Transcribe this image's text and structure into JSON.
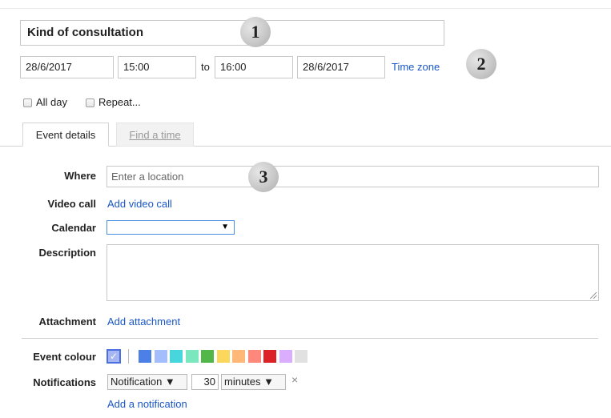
{
  "event": {
    "title": "Kind of consultation",
    "start_date": "28/6/2017",
    "start_time": "15:00",
    "to_label": "to",
    "end_time": "16:00",
    "end_date": "28/6/2017",
    "time_zone_link": "Time zone",
    "all_day_label": "All day",
    "repeat_label": "Repeat..."
  },
  "markers": [
    "1",
    "2",
    "3"
  ],
  "tabs": [
    {
      "label": "Event details",
      "active": true
    },
    {
      "label": "Find a time",
      "active": false
    }
  ],
  "details": {
    "where_label": "Where",
    "where_placeholder": "Enter a location",
    "video_call_label": "Video call",
    "add_video_call": "Add video call",
    "calendar_label": "Calendar",
    "calendar_value": "",
    "calendar_arrow": "▼",
    "description_label": "Description",
    "attachment_label": "Attachment",
    "add_attachment": "Add attachment",
    "event_colour_label": "Event colour",
    "selected_colour_check": "✓",
    "colours": [
      "#4d80e6",
      "#a4bdfc",
      "#46d6db",
      "#7ae7bf",
      "#51b749",
      "#fbd75b",
      "#ffb878",
      "#ff887c",
      "#dc2127",
      "#dbadff",
      "#e1e1e1"
    ],
    "notifications_label": "Notifications",
    "notification_type": "Notification ▼",
    "notification_amount": "30",
    "notification_unit": "minutes ▼",
    "remove_notification": "×",
    "add_notification": "Add a notification"
  }
}
